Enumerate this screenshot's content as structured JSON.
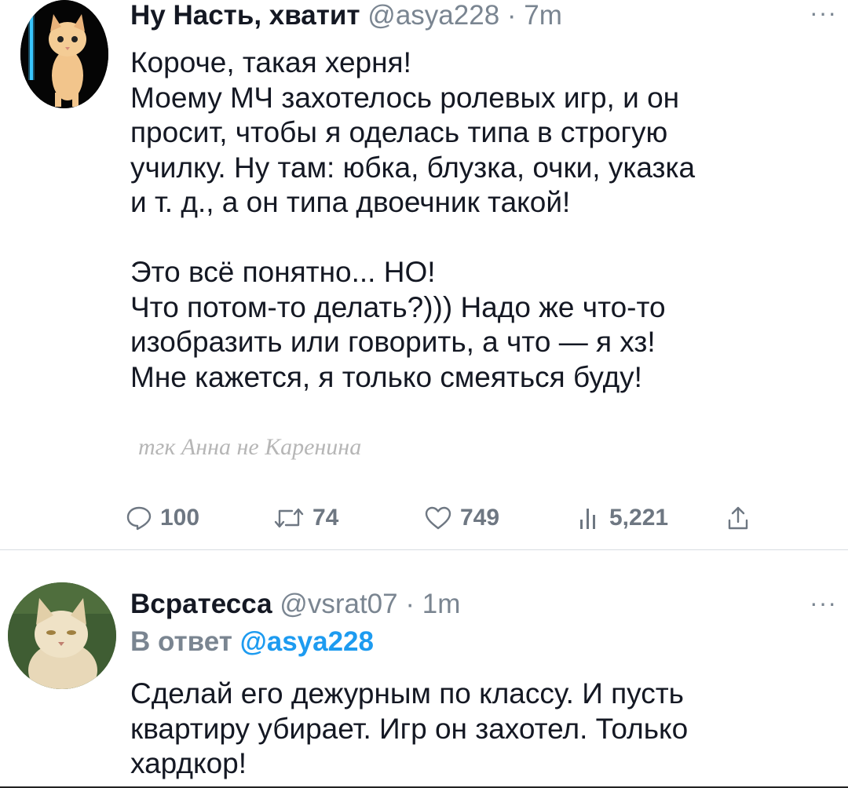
{
  "tweets": [
    {
      "author": {
        "display_name": "Ну Насть, хватит",
        "handle": "@asya228"
      },
      "separator": "·",
      "time": "7m",
      "more": "···",
      "body_lines": [
        "Короче, такая херня!",
        "Моему МЧ захотелось ролевых игр, и он",
        "просит, чтобы я оделась типа в строгую",
        "училку. Ну там: юбка, блузка, очки, указка",
        "и т. д., а он типа двоечник такой!",
        "",
        "Это всё понятно... НО!",
        "Что потом-то делать?))) Надо же что-то",
        "изобразить или говорить, а что — я хз!",
        "Мне кажется, я только смеяться буду!"
      ],
      "watermark": "тгк Анна не Каренина",
      "actions": {
        "reply": {
          "icon": "reply-icon",
          "count": "100"
        },
        "retweet": {
          "icon": "retweet-icon",
          "count": "74"
        },
        "like": {
          "icon": "heart-icon",
          "count": "749"
        },
        "views": {
          "icon": "views-icon",
          "count": "5,221"
        },
        "share": {
          "icon": "share-icon"
        }
      }
    },
    {
      "author": {
        "display_name": "Всратесса",
        "handle": "@vsrat07"
      },
      "separator": "·",
      "time": "1m",
      "more": "···",
      "reply_to": {
        "label": "В ответ",
        "handle": "@asya228"
      },
      "body_lines": [
        "Сделай его дежурным по классу. И пусть",
        "квартиру убирает. Игр он захотел. Только",
        "хардкор!"
      ]
    }
  ],
  "colors": {
    "text": "#141823",
    "secondary": "#7a8591",
    "accent": "#1d9bf0",
    "divider": "#d8dde2"
  }
}
